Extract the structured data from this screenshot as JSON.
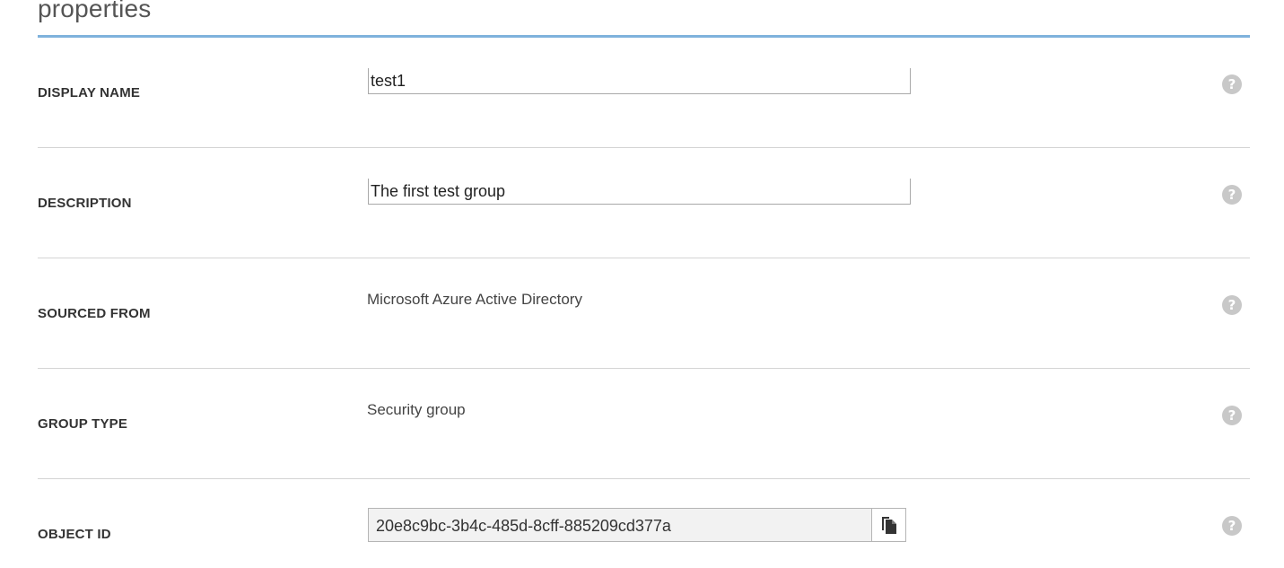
{
  "section": {
    "title": "properties"
  },
  "colors": {
    "accent_rule": "#7fb2dc",
    "divider": "#d4d4d4",
    "help_icon": "#c8c8c8",
    "readonly_bg": "#f2f2f2"
  },
  "fields": {
    "display_name": {
      "label": "DISPLAY NAME",
      "value": "test1",
      "help_icon": "question-mark"
    },
    "description": {
      "label": "DESCRIPTION",
      "value": "The first test group",
      "help_icon": "question-mark"
    },
    "sourced_from": {
      "label": "SOURCED FROM",
      "value": "Microsoft Azure Active Directory",
      "help_icon": "question-mark"
    },
    "group_type": {
      "label": "GROUP TYPE",
      "value": "Security group",
      "help_icon": "question-mark"
    },
    "object_id": {
      "label": "OBJECT ID",
      "value": "20e8c9bc-3b4c-485d-8cff-885209cd377a",
      "copy_icon": "copy-documents",
      "help_icon": "question-mark"
    }
  },
  "help_glyph": "?"
}
